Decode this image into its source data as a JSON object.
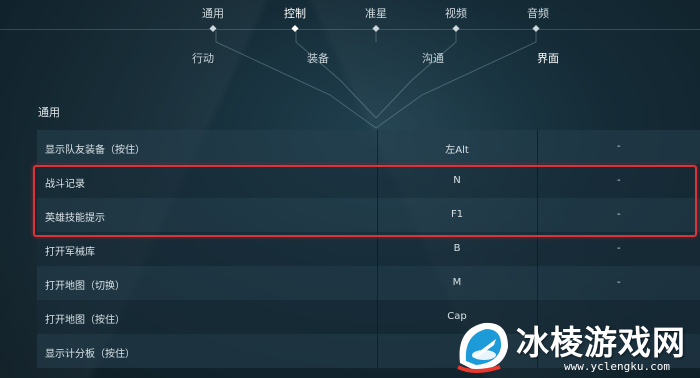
{
  "top_tabs": [
    {
      "label": "通用",
      "active": false
    },
    {
      "label": "控制",
      "active": true
    },
    {
      "label": "准星",
      "active": false
    },
    {
      "label": "视频",
      "active": false
    },
    {
      "label": "音频",
      "active": false
    }
  ],
  "sub_tabs": [
    {
      "label": "行动",
      "active": false
    },
    {
      "label": "装备",
      "active": false
    },
    {
      "label": "沟通",
      "active": false
    },
    {
      "label": "界面",
      "active": true
    }
  ],
  "section_title": "通用",
  "keybind_rows": [
    {
      "action": "显示队友装备（按住）",
      "primary": "左Alt",
      "secondary": "-"
    },
    {
      "action": "战斗记录",
      "primary": "N",
      "secondary": "-"
    },
    {
      "action": "英雄技能提示",
      "primary": "F1",
      "secondary": "-"
    },
    {
      "action": "打开军械库",
      "primary": "B",
      "secondary": "-"
    },
    {
      "action": "打开地图（切换）",
      "primary": "M",
      "secondary": "-"
    },
    {
      "action": "打开地图（按住）",
      "primary": "Cap",
      "secondary": ""
    },
    {
      "action": "显示计分板（按住）",
      "primary": "",
      "secondary": ""
    }
  ],
  "highlight_color": "#d9343a",
  "watermark": {
    "text": "冰棱游戏网",
    "url": "www.yclengku.com"
  }
}
